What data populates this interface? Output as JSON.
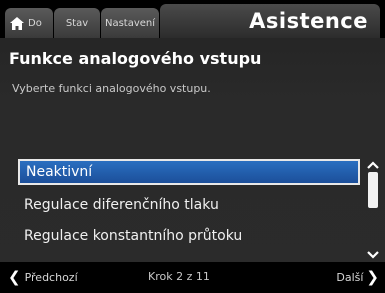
{
  "tabs": {
    "home": {
      "label": "Do",
      "icon": "home-icon"
    },
    "stav": {
      "label": "Stav"
    },
    "nastaveni": {
      "label": "Nastavení"
    },
    "active": {
      "label": "Asistence"
    }
  },
  "header": {
    "title": "Funkce analogového vstupu",
    "subtitle": "Vyberte funkci analogového vstupu."
  },
  "list": {
    "items": [
      {
        "label": "Neaktivní",
        "selected": true
      },
      {
        "label": "Regulace diferenčního tlaku",
        "selected": false
      },
      {
        "label": "Regulace konstantního průtoku",
        "selected": false
      }
    ]
  },
  "footer": {
    "back_label": "Předchozí",
    "step_label": "Krok 2 z 11",
    "next_label": "Další"
  },
  "colors": {
    "selection": "#1c4f9a",
    "background": "#2a2a2a"
  }
}
